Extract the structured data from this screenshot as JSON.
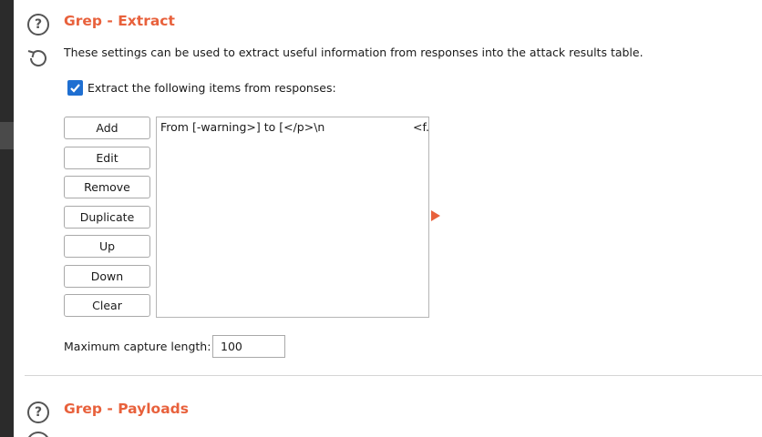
{
  "grep_extract": {
    "title": "Grep - Extract",
    "description": "These settings can be used to extract useful information from responses into the attack results table.",
    "checkbox": {
      "label": "Extract the following items from responses:",
      "checked": true
    },
    "buttons": {
      "add": "Add",
      "edit": "Edit",
      "remove": "Remove",
      "duplicate": "Duplicate",
      "up": "Up",
      "down": "Down",
      "clear": "Clear"
    },
    "items": [
      {
        "expression": "From [-warning>] to [</p>\\n",
        "extra": "<f."
      }
    ],
    "max_capture": {
      "label": "Maximum capture length:",
      "value": "100"
    }
  },
  "grep_payloads": {
    "title": "Grep - Payloads"
  },
  "colors": {
    "accent": "#e8613c",
    "checkbox": "#1f6fd1",
    "sidebar": "#2b2b2b"
  }
}
